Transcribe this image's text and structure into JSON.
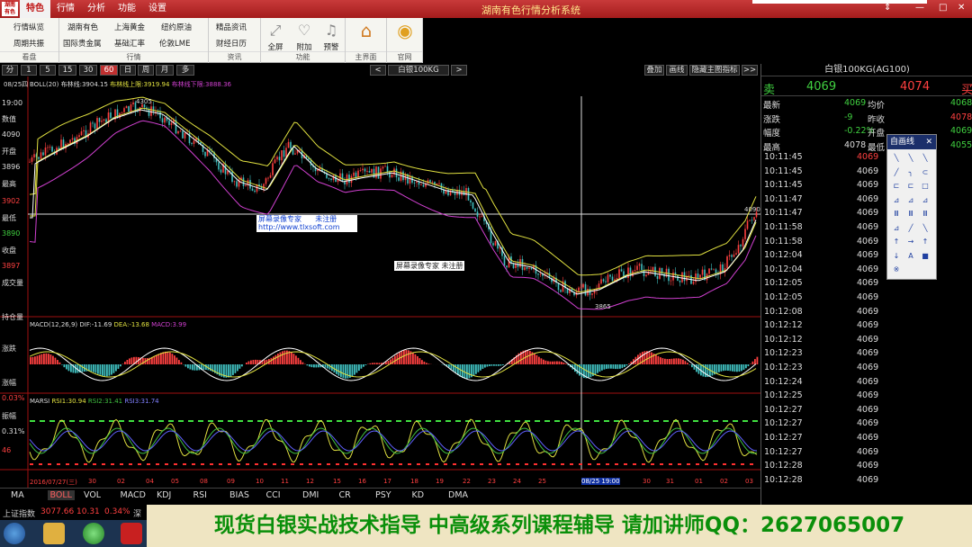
{
  "title": {
    "logo": "湖南\n有色",
    "menu": [
      "特色",
      "行情",
      "分析",
      "功能",
      "设置"
    ],
    "app_title": "湖南有色行情分析系统",
    "win_buttons": [
      "⇕",
      "—",
      "□",
      "✕"
    ]
  },
  "toolbar": {
    "grp1": {
      "items": [
        "行情纵览",
        "周期共振"
      ],
      "label": "看盘"
    },
    "grp2": {
      "items": [
        "湖南有色",
        "上海黄金",
        "纽约原油",
        "国际贵金属",
        "基础汇率",
        "伦敦LME"
      ],
      "label": "行情"
    },
    "grp3": {
      "items": [
        "精品资讯",
        "财经日历"
      ],
      "label": "资讯"
    },
    "grp4": {
      "items": [
        "全屏",
        "附加",
        "预警"
      ],
      "label": "功能"
    },
    "grp5": {
      "items": [
        "主界面"
      ],
      "label": "主界面"
    },
    "grp6": {
      "items": [
        "官网"
      ],
      "label": "官网"
    }
  },
  "periodbar": {
    "periods": [
      "分",
      "1",
      "5",
      "15",
      "30",
      "60",
      "日",
      "周",
      "月",
      "多"
    ],
    "active_period": "60",
    "nav_prev": "<",
    "symbol": "白银100KG",
    "nav_next": ">",
    "actions": [
      "叠加",
      "画线",
      "隐藏主图指标",
      ">>"
    ]
  },
  "chart": {
    "date_label": "08/25四",
    "boll_header": {
      "name": "BOLL(20)",
      "mid": "布林线:3904.15",
      "upper": "布林线上限:3919.94",
      "lower": "布林线下限:3888.36"
    },
    "left_labels": [
      {
        "text": "19:00",
        "color": "#dddddd"
      },
      {
        "text": "数值",
        "color": "#dddddd"
      },
      {
        "text": "4090",
        "color": "#dddddd"
      },
      {
        "text": "开盘",
        "color": "#dddddd"
      },
      {
        "text": "3896",
        "color": "#dddddd"
      },
      {
        "text": "最高",
        "color": "#dddddd"
      },
      {
        "text": "3902",
        "color": "#ff4040"
      },
      {
        "text": "最低",
        "color": "#dddddd"
      },
      {
        "text": "3890",
        "color": "#40d040"
      },
      {
        "text": "收盘",
        "color": "#dddddd"
      },
      {
        "text": "3897",
        "color": "#ff4040"
      },
      {
        "text": "成交量",
        "color": "#dddddd"
      },
      {
        "text": "持仓量",
        "color": "#dddddd"
      },
      {
        "text": "涨跌",
        "color": "#dddddd"
      },
      {
        "text": "涨幅",
        "color": "#dddddd"
      },
      {
        "text": "0.03%",
        "color": "#ff4040"
      },
      {
        "text": "振幅",
        "color": "#dddddd"
      },
      {
        "text": "0.31%",
        "color": "#dddddd"
      },
      {
        "text": "46",
        "color": "#ff4040"
      }
    ],
    "price_high_label": "4305",
    "price_low_label": "3865",
    "price_right_label": "4090",
    "watermark1": {
      "line1": "屏幕录像专家      未注册",
      "line2": "http://www.tlxsoft.com"
    },
    "watermark2": "屏幕录像专家 未注册",
    "macd_header": {
      "name": "MACD(12,26,9)",
      "dif": "DIF:-11.69",
      "dea": "DEA:-13.68",
      "macd": "MACD:3.99"
    },
    "rsi_header": {
      "name": "MARSI",
      "rsi1": "RSI1:30.94",
      "rsi2": "RSI2:31.41",
      "rsi3": "RSI3:31.74"
    },
    "x_labels": [
      "2016/07/27(三)",
      "30",
      "02",
      "04",
      "05",
      "08",
      "09",
      "10",
      "11",
      "12",
      "15",
      "16",
      "17",
      "18",
      "19",
      "22",
      "23",
      "24",
      "25",
      "08/25 19:00",
      "30",
      "31",
      "01",
      "02",
      "03"
    ]
  },
  "rightpanel": {
    "title": "白银100KG(AG100)",
    "sell_label": "卖",
    "sell_price": "4069",
    "buy_price": "4074",
    "buy_label": "买",
    "stats": [
      {
        "l1": "最新",
        "v1": "4069",
        "c1": "#40d040",
        "l2": "均价",
        "v2": "4068",
        "c2": "#40d040"
      },
      {
        "l1": "涨跌",
        "v1": "-9",
        "c1": "#40d040",
        "l2": "昨收",
        "v2": "4078",
        "c2": "#ff4040"
      },
      {
        "l1": "幅度",
        "v1": "-0.22%",
        "c1": "#40d040",
        "l2": "开盘",
        "v2": "4069",
        "c2": "#40d040"
      },
      {
        "l1": "最高",
        "v1": "4078",
        "c1": "#dddddd",
        "l2": "最低",
        "v2": "4055",
        "c2": "#40d040"
      }
    ],
    "ticks": [
      {
        "time": "10:11:45",
        "price": "4069",
        "color": "#ff4040"
      },
      {
        "time": "10:11:45",
        "price": "4069",
        "color": "#dddddd"
      },
      {
        "time": "10:11:45",
        "price": "4069",
        "color": "#dddddd"
      },
      {
        "time": "10:11:47",
        "price": "4069",
        "color": "#dddddd"
      },
      {
        "time": "10:11:47",
        "price": "4069",
        "color": "#dddddd"
      },
      {
        "time": "10:11:58",
        "price": "4069",
        "color": "#dddddd"
      },
      {
        "time": "10:11:58",
        "price": "4069",
        "color": "#dddddd"
      },
      {
        "time": "10:12:04",
        "price": "4069",
        "color": "#dddddd"
      },
      {
        "time": "10:12:04",
        "price": "4069",
        "color": "#dddddd"
      },
      {
        "time": "10:12:05",
        "price": "4069",
        "color": "#dddddd"
      },
      {
        "time": "10:12:05",
        "price": "4069",
        "color": "#dddddd"
      },
      {
        "time": "10:12:08",
        "price": "4069",
        "color": "#dddddd"
      },
      {
        "time": "10:12:12",
        "price": "4069",
        "color": "#dddddd"
      },
      {
        "time": "10:12:12",
        "price": "4069",
        "color": "#dddddd"
      },
      {
        "time": "10:12:23",
        "price": "4069",
        "color": "#dddddd"
      },
      {
        "time": "10:12:23",
        "price": "4069",
        "color": "#dddddd"
      },
      {
        "time": "10:12:24",
        "price": "4069",
        "color": "#dddddd"
      },
      {
        "time": "10:12:25",
        "price": "4069",
        "color": "#dddddd"
      },
      {
        "time": "10:12:27",
        "price": "4069",
        "color": "#dddddd"
      },
      {
        "time": "10:12:27",
        "price": "4069",
        "color": "#dddddd"
      },
      {
        "time": "10:12:27",
        "price": "4069",
        "color": "#dddddd"
      },
      {
        "time": "10:12:27",
        "price": "4069",
        "color": "#dddddd"
      },
      {
        "time": "10:12:28",
        "price": "4069",
        "color": "#dddddd"
      },
      {
        "time": "10:12:28",
        "price": "4069",
        "color": "#dddddd"
      }
    ]
  },
  "drawtools": {
    "title": "自画线",
    "close": "✕"
  },
  "indicator_tabs": [
    "MA",
    "BOLL",
    "VOL",
    "MACD",
    "KDJ",
    "RSI",
    "BIAS",
    "CCI",
    "DMI",
    "CR",
    "PSY",
    "KD",
    "DMA"
  ],
  "active_indicator": "BOLL",
  "statusbar": {
    "index_name": "上证指数",
    "index_value": "3077.66",
    "change": "10.31",
    "pct": "0.34%",
    "extra": "深证"
  },
  "banner": "现货白银实战技术指导 中高级系列课程辅导 请加讲师QQ：2627065007"
}
